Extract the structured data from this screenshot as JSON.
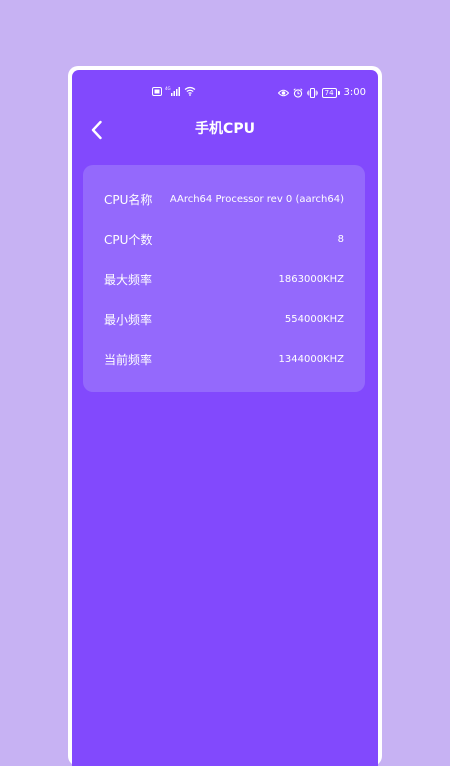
{
  "status_bar": {
    "time": "3:00",
    "battery": "74",
    "signal": "4G"
  },
  "header": {
    "title": "手机CPU"
  },
  "cpu_info": {
    "rows": [
      {
        "label": "CPU名称",
        "value": "AArch64 Processor rev 0 (aarch64)"
      },
      {
        "label": "CPU个数",
        "value": "8"
      },
      {
        "label": "最大频率",
        "value": "1863000KHZ"
      },
      {
        "label": "最小频率",
        "value": "554000KHZ"
      },
      {
        "label": "当前频率",
        "value": "1344000KHZ"
      }
    ]
  },
  "colors": {
    "background": "#c7b2f3",
    "screen": "#8249fd",
    "card": "#9469fc",
    "text": "#ffffff"
  },
  "icons": [
    "nfc-icon",
    "signal-icon",
    "wifi-icon",
    "eye-icon",
    "alarm-icon",
    "vibrate-icon",
    "battery-icon",
    "back-arrow-icon"
  ]
}
